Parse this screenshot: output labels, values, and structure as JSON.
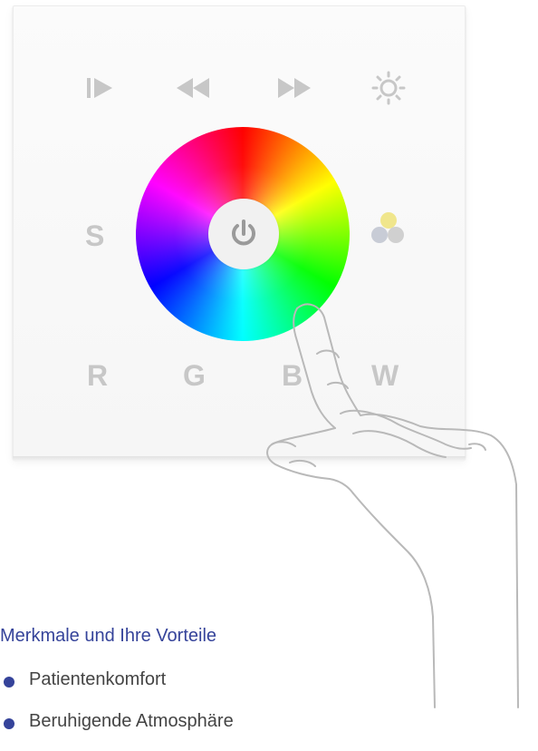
{
  "panel": {
    "transport_icons": [
      "play-pause-icon",
      "rewind-icon",
      "fast-forward-icon",
      "brightness-icon"
    ],
    "color_wheel_center_icon": "power-icon",
    "s_label": "S",
    "channel_labels": {
      "r": "R",
      "g": "G",
      "b": "B",
      "w": "W"
    },
    "rgbw_indicator_icon": "rgbw-dots-icon",
    "colors": {
      "key_gray": "#c7c7c7",
      "power_icon": "#9a9a9a",
      "dot_yellow": "#f0e68c",
      "dot_gray": "#c8ccd6"
    }
  },
  "features": {
    "title": "Merkmale und Ihre Vorteile",
    "items": [
      "Patientenkomfort",
      "Beruhigende Atmosphäre"
    ],
    "accent_color": "#35439a"
  }
}
